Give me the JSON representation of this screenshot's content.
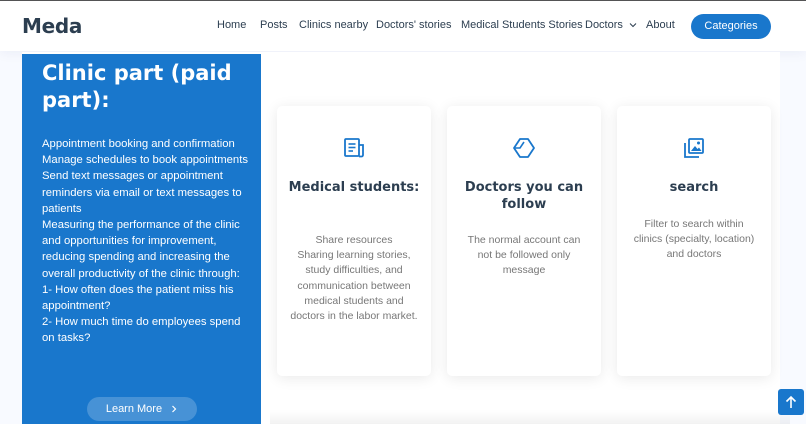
{
  "brand": {
    "logo": "Meda"
  },
  "nav": {
    "items": [
      {
        "label": "Home"
      },
      {
        "label": "Posts"
      },
      {
        "label": "Clinics nearby"
      },
      {
        "label": "Doctors' stories"
      },
      {
        "label": "Medical Students Stories"
      },
      {
        "label": "Doctors"
      },
      {
        "label": "About"
      }
    ],
    "cta": "Categories"
  },
  "panel": {
    "title": "Clinic part (paid part):",
    "body": "Appointment booking and confirmation\nManage schedules to book appointments\nSend text messages or appointment reminders via email or text messages to patients\nMeasuring the performance of the clinic and opportunities for improvement, reducing spending and increasing the overall productivity of the clinic through:\n1- How often does the patient miss his appointment?\n2- How much time do employees spend on tasks?",
    "button": "Learn More",
    "button_icon": "chevron-right-icon"
  },
  "cards": [
    {
      "icon": "document-icon",
      "title": "Medical students:",
      "text": "Share resources\nSharing learning stories, study difficulties, and communication between medical students and doctors in the labor market."
    },
    {
      "icon": "cube-icon",
      "title": "Doctors you can follow",
      "text": "The normal account can not be followed only message"
    },
    {
      "icon": "images-icon",
      "title": "search",
      "text": "Filter to search within clinics (specialty, location) and doctors"
    }
  ],
  "back_to_top": {
    "icon": "arrow-up-icon"
  },
  "colors": {
    "accent": "#1977cc",
    "heading": "#2c3e50",
    "muted": "#777777"
  }
}
